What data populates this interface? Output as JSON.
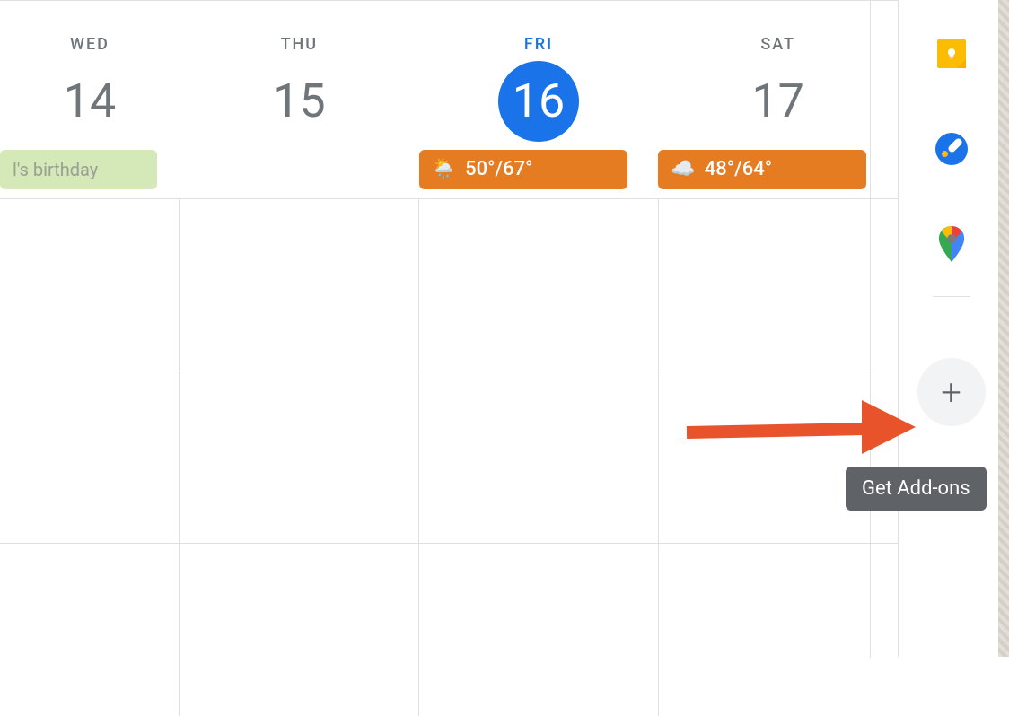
{
  "calendar": {
    "days": [
      {
        "label": "WED",
        "number": "14",
        "is_today": false
      },
      {
        "label": "THU",
        "number": "15",
        "is_today": false
      },
      {
        "label": "FRI",
        "number": "16",
        "is_today": true
      },
      {
        "label": "SAT",
        "number": "17",
        "is_today": false
      }
    ],
    "events": {
      "wed": {
        "birthday_text": "l's birthday"
      },
      "fri": {
        "weather_icon": "🌦️",
        "weather_text": "50°/67°"
      },
      "sat": {
        "weather_icon": "☁️",
        "weather_text": "48°/64°"
      }
    }
  },
  "side_panel": {
    "keep_name": "keep-icon",
    "tasks_name": "tasks-icon",
    "maps_name": "maps-icon",
    "addons_plus": "+",
    "tooltip": "Get Add-ons"
  },
  "colors": {
    "today_blue": "#1a73e8",
    "weather_orange": "#e67c22",
    "birthday_green": "#d4e8b8",
    "arrow_orange": "#e8532b"
  }
}
